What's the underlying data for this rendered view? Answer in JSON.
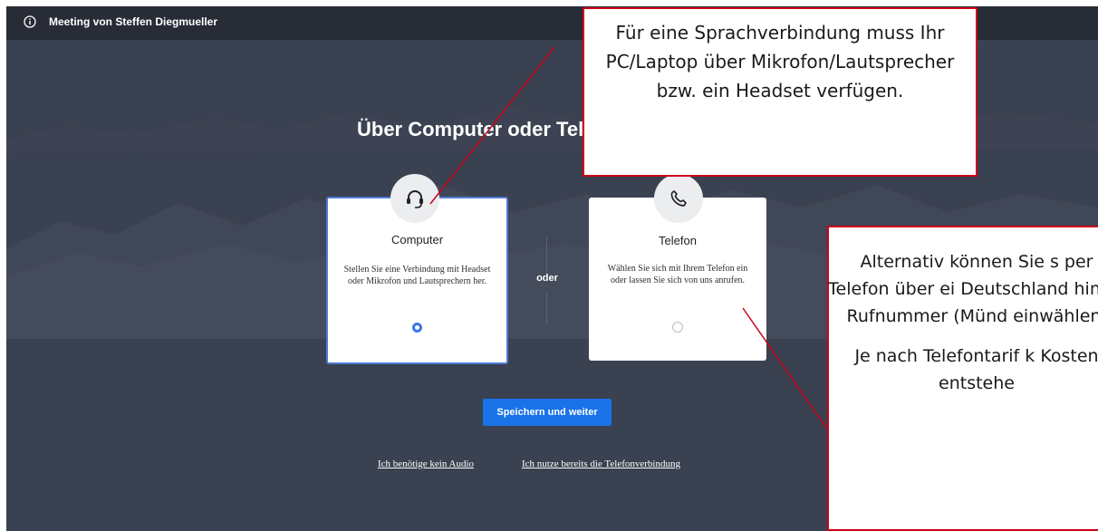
{
  "topbar": {
    "meeting_title": "Meeting von Steffen Diegmueller",
    "icon": "info-icon"
  },
  "main": {
    "heading": "Über Computer oder Tel",
    "or_label": "oder",
    "computer_card": {
      "icon": "headset-icon",
      "title": "Computer",
      "description": "Stellen Sie eine Verbindung mit Headset oder Mikrofon und Lautsprechern her.",
      "selected": true
    },
    "telefon_card": {
      "icon": "phone-icon",
      "title": "Telefon",
      "description": "Wählen Sie sich mit Ihrem Telefon ein oder lassen Sie sich von uns anrufen.",
      "selected": false
    },
    "save_button": "Speichern und weiter",
    "link_no_audio": "Ich benötige kein Audio",
    "link_phone": "Ich nutze bereits die Telefonverbindung"
  },
  "annotations": {
    "headset_note": "Für eine Sprachverbindung muss Ihr PC/Laptop über Mikrofon/Lautsprecher bzw. ein Headset verfügen.",
    "phone_note_1": "Alternativ können Sie s per Telefon über ei Deutschland hinter Rufnummer (Münd einwählen.",
    "phone_note_2": "Je nach Telefontarif k Kosten entstehe"
  },
  "colors": {
    "background": "#3a4150",
    "topbar": "#272c36",
    "accent": "#1a73e8",
    "callout_border": "#d0021b"
  }
}
